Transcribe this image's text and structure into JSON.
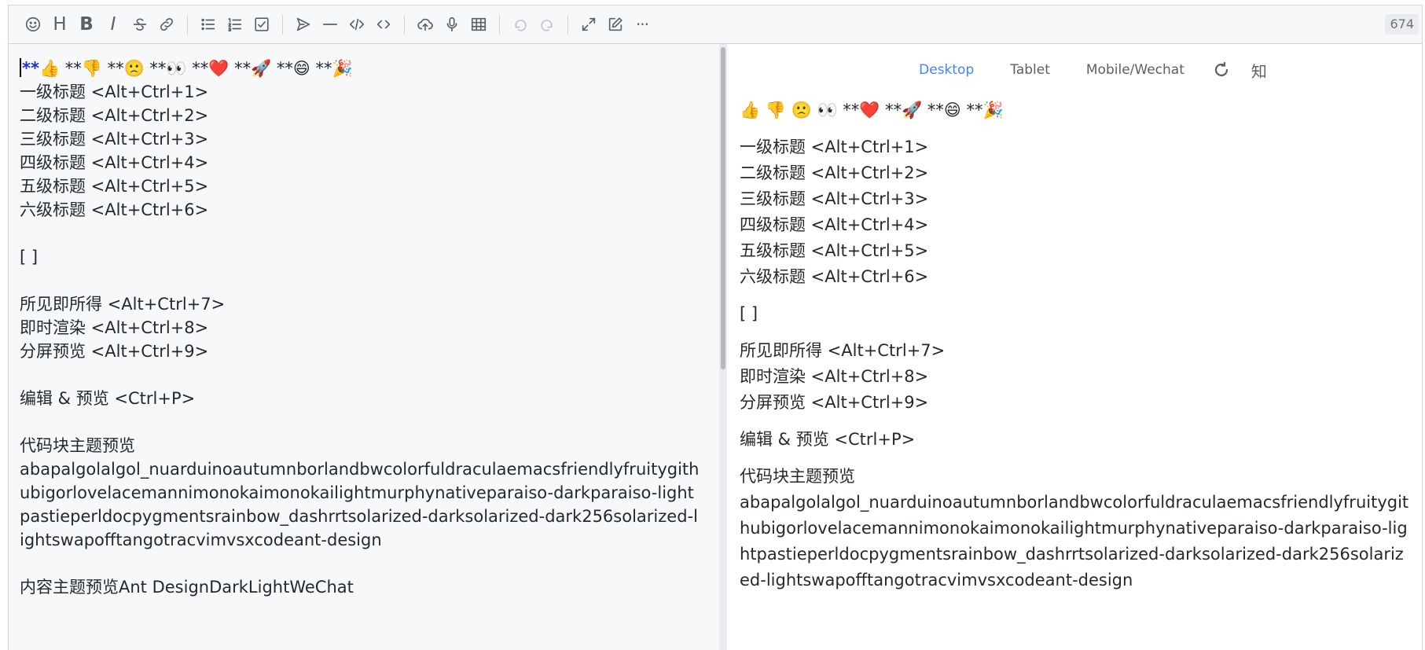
{
  "toolbar": {
    "letters": {
      "heading": "H",
      "bold": "B",
      "italic": "I"
    },
    "more": "···",
    "counter": "674"
  },
  "editor": {
    "line1_marker": "**",
    "line1_rest": "👍 **👎 **🙁 **👀 **❤️ **🚀 **😄 **🎉",
    "body": "\n一级标题 <Alt+Ctrl+1>\n二级标题 <Alt+Ctrl+2>\n三级标题 <Alt+Ctrl+3>\n四级标题 <Alt+Ctrl+4>\n五级标题 <Alt+Ctrl+5>\n六级标题 <Alt+Ctrl+6>\n\n[ ]\n\n所见即所得 <Alt+Ctrl+7>\n即时渲染 <Alt+Ctrl+8>\n分屏预览 <Alt+Ctrl+9>\n\n编辑 & 预览 <Ctrl+P>\n\n代码块主题预览\nabapalgolalgol_nuarduinoautumnborlandbwcolorfuldraculaemacsfriendlyfruitygithubigorlovelacemannimonokaimonokailightmurphynativeparaiso-darkparaiso-lightpastieperldocpygmentsrainbow_dashrrtsolarized-darksolarized-dark256solarized-lightswapofftangotracvimvsxcodeant-design\n\n内容主题预览Ant DesignDarkLightWeChat"
  },
  "preview": {
    "tabs": [
      "Desktop",
      "Tablet",
      "Mobile/Wechat"
    ],
    "zhihu_label": "知",
    "paragraphs": [
      "👍 👎 🙁 👀 **❤️ **🚀 **😄 **🎉",
      "一级标题 <Alt+Ctrl+1>\n二级标题 <Alt+Ctrl+2>\n三级标题 <Alt+Ctrl+3>\n四级标题 <Alt+Ctrl+4>\n五级标题 <Alt+Ctrl+5>\n六级标题 <Alt+Ctrl+6>",
      "[ ]",
      "所见即所得 <Alt+Ctrl+7>\n即时渲染 <Alt+Ctrl+8>\n分屏预览 <Alt+Ctrl+9>",
      "编辑 & 预览 <Ctrl+P>",
      "代码块主题预览\nabapalgolalgol_nuarduinoautumnborlandbwcolorfuldraculaemacsfriendlyfruitygithubigorlovelacemannimonokaimonokailightmurphynativeparaiso-darkparaiso-lightpastieperldocpygmentsrainbow_dashrrtsolarized-darksolarized-dark256solarized-lightswapofftangotracvimvsxcodeant-design"
    ]
  },
  "colors": {
    "accent": "#4285f4",
    "marker": "#1a31c8",
    "editor_bg": "#f6f8fa"
  }
}
